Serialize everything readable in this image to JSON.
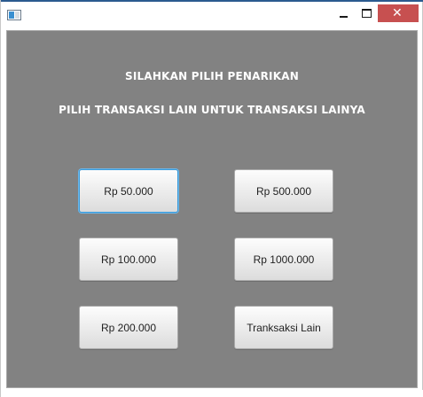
{
  "window": {
    "controls": {
      "minimize_icon": "minimize-icon",
      "maximize_icon": "maximize-icon",
      "close_label": "✕"
    },
    "accent_color": "#c75050"
  },
  "main": {
    "heading": "SILAHKAN PILIH PENARIKAN",
    "subheading": "PILIH TRANSAKSI LAIN UNTUK TRANSAKSI LAINYA",
    "background_color": "#828282"
  },
  "buttons": {
    "amount_50k": "Rp 50.000",
    "amount_500k": "Rp 500.000",
    "amount_100k": "Rp 100.000",
    "amount_1000k": "Rp 1000.000",
    "amount_200k": "Rp 200.000",
    "other": "Tranksaksi Lain"
  }
}
